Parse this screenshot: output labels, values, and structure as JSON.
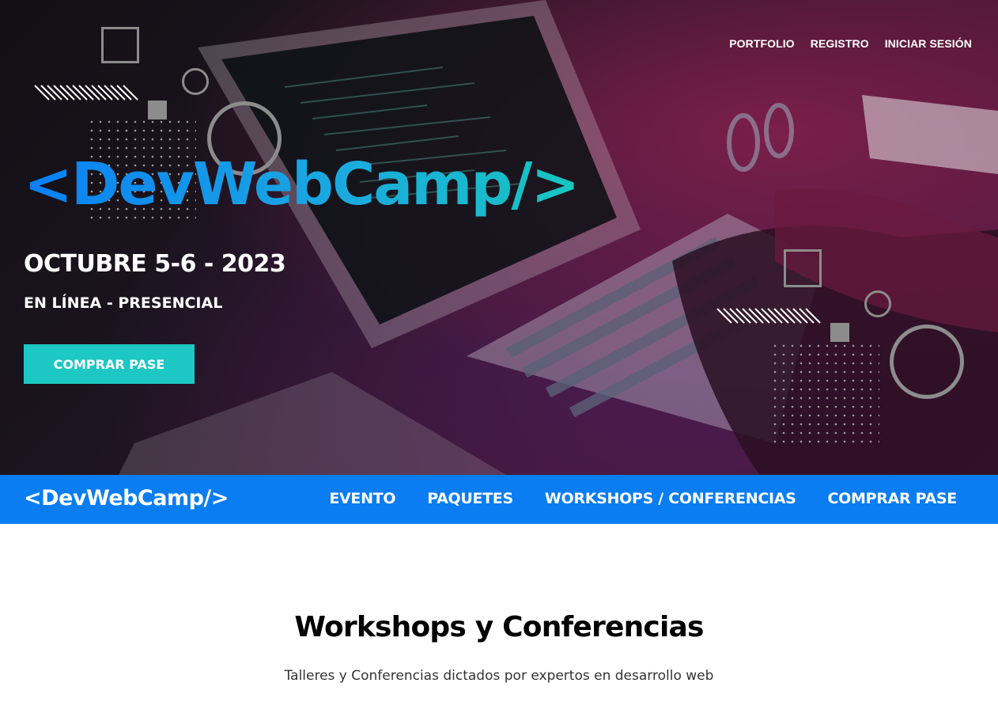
{
  "top_nav": {
    "items": [
      "PORTFOLIO",
      "REGISTRO",
      "INICIAR SESIÓN"
    ]
  },
  "hero": {
    "logo": "<DevWebCamp/>",
    "date": "OCTUBRE 5-6 - 2023",
    "place": "EN LÍNEA - PRESENCIAL",
    "cta": "COMPRAR PASE"
  },
  "bar": {
    "logo": "<DevWebCamp/>",
    "nav": [
      "EVENTO",
      "PAQUETES",
      "WORKSHOPS / CONFERENCIAS",
      "COMPRAR PASE"
    ]
  },
  "section": {
    "title": "Workshops y Conferencias",
    "subtitle": "Talleres y Conferencias dictados por expertos en desarrollo web"
  },
  "colors": {
    "brand_blue": "#0a7df3",
    "cta_teal": "#1dc7c3",
    "logo_gradient_start": "#0a7ff5",
    "logo_gradient_end": "#18c6c0"
  }
}
